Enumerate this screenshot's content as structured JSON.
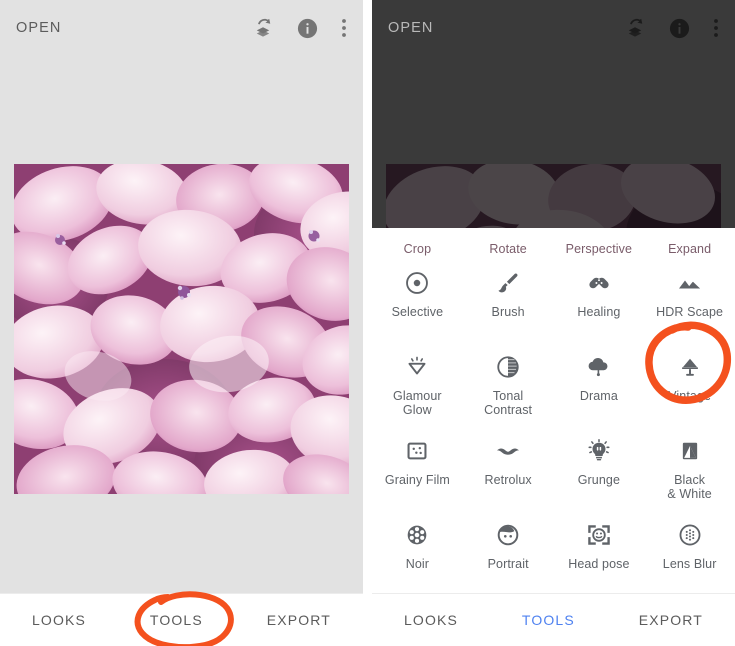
{
  "app": {
    "left": {
      "appbar": {
        "title": "OPEN",
        "icons": [
          {
            "name": "undo-stack-icon",
            "label": "Undo / revert"
          },
          {
            "name": "info-icon",
            "label": "Info"
          },
          {
            "name": "overflow-menu-icon",
            "label": "More options"
          }
        ]
      },
      "photo": {
        "alt": "Pink hydrangea flower petals close-up"
      },
      "bottom_nav": {
        "items": [
          {
            "label": "LOOKS",
            "active": false
          },
          {
            "label": "TOOLS",
            "active": false
          },
          {
            "label": "EXPORT",
            "active": false
          }
        ]
      }
    },
    "right": {
      "appbar": {
        "title": "OPEN",
        "icons": [
          {
            "name": "undo-stack-icon",
            "label": "Undo / revert"
          },
          {
            "name": "info-icon",
            "label": "Info"
          },
          {
            "name": "overflow-menu-icon",
            "label": "More options"
          }
        ]
      },
      "photo": {
        "alt": "Pink hydrangea flower petals close-up, dimmed"
      },
      "tools_sheet": {
        "clipped_row_labels": [
          "Crop",
          "Rotate",
          "Perspective",
          "Expand"
        ],
        "rows": [
          [
            {
              "label": "Selective",
              "icon": "selective-icon"
            },
            {
              "label": "Brush",
              "icon": "brush-icon"
            },
            {
              "label": "Healing",
              "icon": "healing-icon"
            },
            {
              "label": "HDR Scape",
              "icon": "hdr-scape-icon"
            }
          ],
          [
            {
              "label": "Glamour\nGlow",
              "icon": "glamour-glow-icon"
            },
            {
              "label": "Tonal\nContrast",
              "icon": "tonal-contrast-icon"
            },
            {
              "label": "Drama",
              "icon": "drama-icon"
            },
            {
              "label": "Vintage",
              "icon": "vintage-icon",
              "highlighted": true
            }
          ],
          [
            {
              "label": "Grainy Film",
              "icon": "grainy-film-icon"
            },
            {
              "label": "Retrolux",
              "icon": "retrolux-icon"
            },
            {
              "label": "Grunge",
              "icon": "grunge-icon"
            },
            {
              "label": "Black\n& White",
              "icon": "black-and-white-icon"
            }
          ],
          [
            {
              "label": "Noir",
              "icon": "noir-icon"
            },
            {
              "label": "Portrait",
              "icon": "portrait-icon"
            },
            {
              "label": "Head pose",
              "icon": "head-pose-icon"
            },
            {
              "label": "Lens Blur",
              "icon": "lens-blur-icon"
            }
          ]
        ]
      },
      "bottom_nav": {
        "items": [
          {
            "label": "LOOKS",
            "active": false
          },
          {
            "label": "TOOLS",
            "active": true
          },
          {
            "label": "EXPORT",
            "active": false
          }
        ]
      }
    }
  },
  "annotations": {
    "color": "#F4511E",
    "items": [
      {
        "name": "tools-tab-highlight-circle",
        "target": "TOOLS"
      },
      {
        "name": "vintage-tool-highlight-circle",
        "target": "Vintage"
      }
    ]
  },
  "colors": {
    "light_bg": "#e2e2e2",
    "dark_bg": "#3a3a3a",
    "sheet_bg": "#ffffff",
    "icon_gray": "#5f6368",
    "accent_blue": "#4f82f0",
    "marker_orange": "#F4511E"
  }
}
